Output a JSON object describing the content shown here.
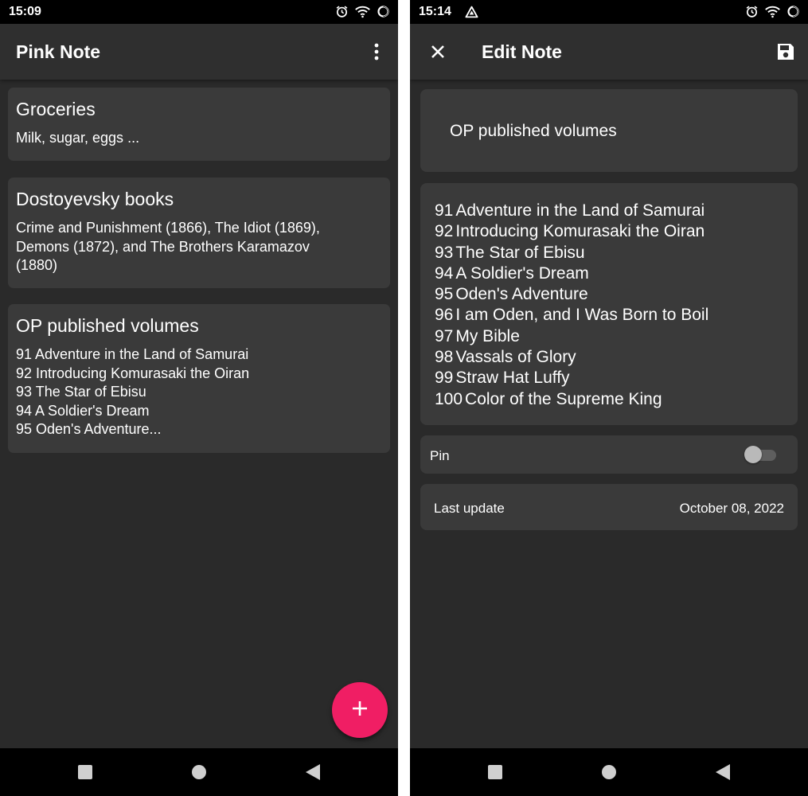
{
  "left_screen": {
    "status_bar": {
      "time": "15:09"
    },
    "app_bar": {
      "title": "Pink Note",
      "menu_icon": "more-vert-icon"
    },
    "notes": [
      {
        "title": "Groceries",
        "lines": [
          "Milk, sugar, eggs ..."
        ]
      },
      {
        "title": "Dostoyevsky books",
        "lines": [
          "Crime and Punishment (1866), The Idiot (1869),",
          "Demons (1872), and The Brothers Karamazov",
          "(1880)"
        ]
      },
      {
        "title": "OP published volumes",
        "lines": [
          "91 Adventure in the Land of Samurai",
          "92 Introducing Komurasaki the Oiran",
          "93 The Star of Ebisu",
          "94 A Soldier's Dream",
          "95 Oden's Adventure..."
        ]
      }
    ],
    "fab_icon": "plus-icon"
  },
  "right_screen": {
    "status_bar": {
      "time": "15:14"
    },
    "app_bar": {
      "title": "Edit Note",
      "close_icon": "close-icon",
      "save_icon": "save-icon"
    },
    "title_field": {
      "value": "OP published volumes"
    },
    "body_field": {
      "lines": [
        {
          "num": "91",
          "text": "Adventure in the Land of Samurai"
        },
        {
          "num": "92",
          "text": "Introducing Komurasaki the Oiran"
        },
        {
          "num": "93",
          "text": "The Star of Ebisu"
        },
        {
          "num": "94",
          "text": "A Soldier's Dream"
        },
        {
          "num": "95",
          "text": "Oden's Adventure"
        },
        {
          "num": "96",
          "text": "I am Oden, and I Was Born to Boil"
        },
        {
          "num": "97",
          "text": "My Bible"
        },
        {
          "num": "98",
          "text": "Vassals of Glory"
        },
        {
          "num": "99",
          "text": "Straw Hat Luffy"
        },
        {
          "num": "100",
          "text": "Color of the Supreme King"
        }
      ]
    },
    "pin": {
      "label": "Pin",
      "enabled": false
    },
    "last_update": {
      "label": "Last update",
      "value": "October 08, 2022"
    }
  },
  "colors": {
    "background": "#2a2a2a",
    "card": "#3a3a3a",
    "app_bar": "#2f2f2f",
    "accent": "#f01e64",
    "status_bar": "#000000"
  }
}
